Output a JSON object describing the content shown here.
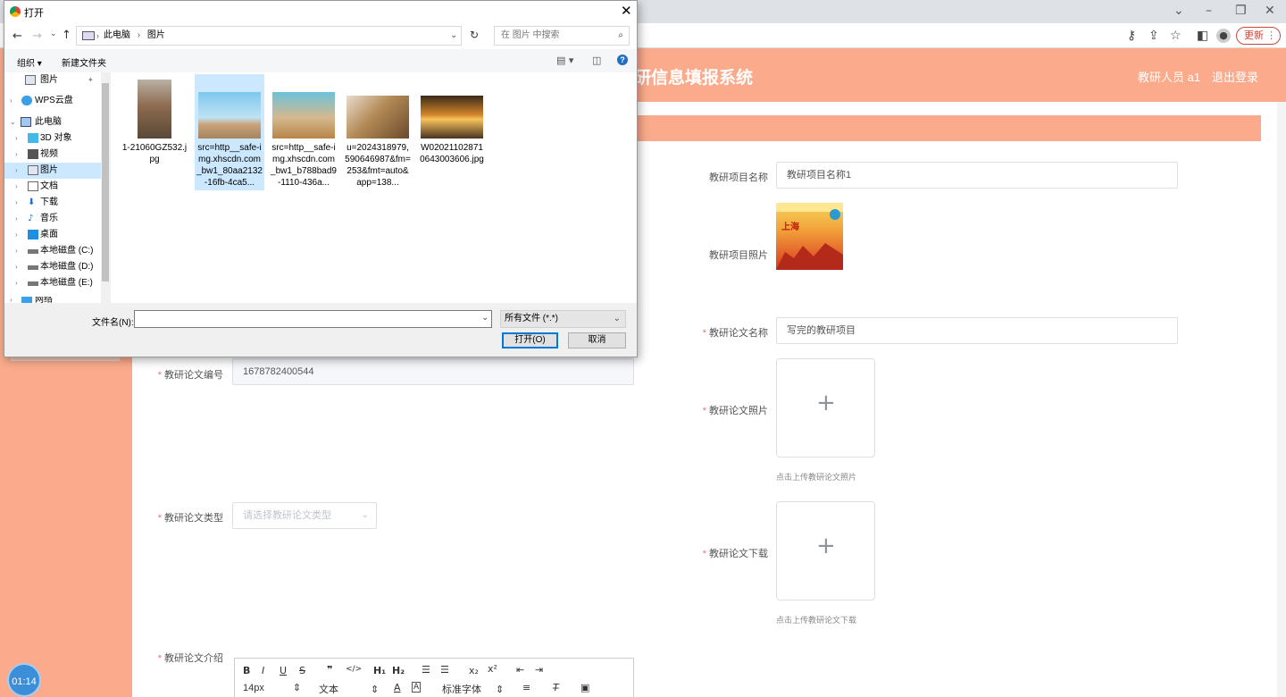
{
  "browser": {
    "update_label": "更新",
    "update_dots": "⋮"
  },
  "app": {
    "title": "科研信息填报系统",
    "visible_title": "研信息填报系统",
    "user": "教研人员 a1",
    "logout": "退出登录"
  },
  "form": {
    "project_name_label": "教研项目名称",
    "project_name_value": "教研项目名称1",
    "project_photo_label": "教研项目照片",
    "paper_name_label": "教研论文名称",
    "paper_name_value": "写完的教研项目",
    "paper_photo_label": "教研论文照片",
    "paper_photo_hint": "点击上传教研论文照片",
    "paper_no_label": "教研论文编号",
    "paper_no_value": "1678782400544",
    "paper_type_label": "教研论文类型",
    "paper_type_placeholder": "请选择教研论文类型",
    "paper_file_label": "教研论文下载",
    "paper_file_hint": "点击上传教研论文下载",
    "paper_intro_label": "教研论文介绍"
  },
  "editor": {
    "size": "14px",
    "text": "文本",
    "font": "标准字体"
  },
  "timer": "01:14",
  "dialog": {
    "title": "打开",
    "breadcrumb": [
      "此电脑",
      "图片"
    ],
    "search_placeholder": "在 图片 中搜索",
    "organize": "组织 ▾",
    "new_folder": "新建文件夹",
    "nav": [
      {
        "label": "图片",
        "exp": ""
      },
      {
        "label": "WPS云盘",
        "exp": "›"
      },
      {
        "label": "此电脑",
        "exp": "⌄"
      },
      {
        "label": "3D 对象",
        "exp": "›"
      },
      {
        "label": "视频",
        "exp": "›"
      },
      {
        "label": "图片",
        "exp": "›"
      },
      {
        "label": "文档",
        "exp": "›"
      },
      {
        "label": "下载",
        "exp": "›"
      },
      {
        "label": "音乐",
        "exp": "›"
      },
      {
        "label": "桌面",
        "exp": "›"
      },
      {
        "label": "本地磁盘 (C:)",
        "exp": "›"
      },
      {
        "label": "本地磁盘 (D:)",
        "exp": "›"
      },
      {
        "label": "本地磁盘 (E:)",
        "exp": "›"
      },
      {
        "label": "网络",
        "exp": "›"
      }
    ],
    "files": [
      "1-21060GZ532.jpg",
      "src=http__safe-img.xhscdn.com_bw1_80aa2132-16fb-4ca5...",
      "src=http__safe-img.xhscdn.com_bw1_b788bad9-1110-436a...",
      "u=2024318979,590646987&fm=253&fmt=auto&app=138...",
      "W020211028710643003606.jpg"
    ],
    "filename_label": "文件名(N):",
    "filter": "所有文件 (*.*)",
    "open_label": "打开(O)",
    "cancel_label": "取消"
  }
}
